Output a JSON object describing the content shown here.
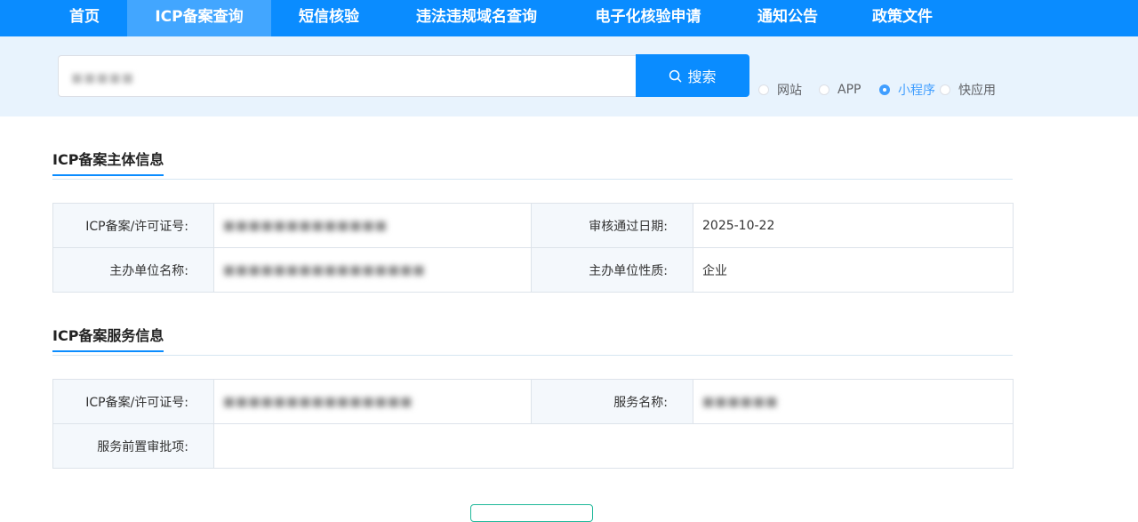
{
  "nav": {
    "items": [
      {
        "label": "首页",
        "active": false
      },
      {
        "label": "ICP备案查询",
        "active": true
      },
      {
        "label": "短信核验",
        "active": false
      },
      {
        "label": "违法违规域名查询",
        "active": false
      },
      {
        "label": "电子化核验申请",
        "active": false
      },
      {
        "label": "通知公告",
        "active": false
      },
      {
        "label": "政策文件",
        "active": false
      }
    ]
  },
  "search": {
    "value": "■■■■■",
    "button_label": "搜索",
    "types": [
      {
        "label": "网站",
        "checked": false
      },
      {
        "label": "APP",
        "checked": false
      },
      {
        "label": "小程序",
        "checked": true
      },
      {
        "label": "快应用",
        "checked": false
      }
    ]
  },
  "subject_info": {
    "title": "ICP备案主体信息",
    "rows": [
      {
        "label1": "ICP备案/许可证号:",
        "value1": "■■■■■■■■■■■■■",
        "label2": "审核通过日期:",
        "value2": "2025-10-22"
      },
      {
        "label1": "主办单位名称:",
        "value1": "■■■■■■■■■■■■■■■■",
        "label2": "主办单位性质:",
        "value2": "企业"
      }
    ]
  },
  "service_info": {
    "title": "ICP备案服务信息",
    "rows": [
      {
        "label1": "ICP备案/许可证号:",
        "value1": "■■■■■■■■■■■■■■■",
        "label2": "服务名称:",
        "value2": "■■■■■■"
      },
      {
        "label1": "服务前置审批项:",
        "value1": ""
      }
    ]
  },
  "colors": {
    "primary": "#0a8cff",
    "nav_active": "#42a6ff",
    "band": "#e8f3fd",
    "radio_checked": "#409eff"
  }
}
